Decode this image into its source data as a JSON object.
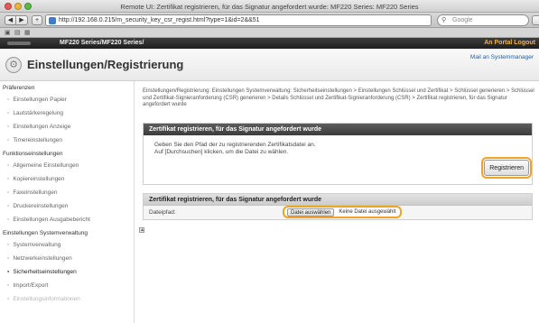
{
  "window": {
    "title": "Remote UI: Zertifikat registrieren, für das Signatur angefordert wurde: MF220 Series: MF220 Series"
  },
  "toolbar": {
    "back_icon": "chevron-left-icon",
    "forward_icon": "chevron-right-icon",
    "url": "http://192.168.0.215/m_security_key_csr_regist.html?type=1&id=2&&51",
    "reload_label": "C",
    "search_placeholder": "Google"
  },
  "appbar": {
    "title": "MF220 Series/MF220 Series/",
    "portal_label": "An Portal  Logout"
  },
  "page": {
    "title": "Einstellungen/Registrierung",
    "mail_link": "Mail an Systemmanager"
  },
  "sidebar": {
    "sections": [
      {
        "label": "Präferenzen",
        "items": [
          {
            "label": "Einstellungen Papier"
          },
          {
            "label": "Lautstärkeregelung"
          },
          {
            "label": "Einstellungen Anzeige"
          },
          {
            "label": "Timereinstellungen"
          }
        ]
      },
      {
        "label": "Funktionseinstellungen",
        "items": [
          {
            "label": "Allgemeine Einstellungen"
          },
          {
            "label": "Kopiereinstellungen"
          },
          {
            "label": "Faxeinstellungen"
          },
          {
            "label": "Druckereinstellungen"
          },
          {
            "label": "Einstellungen Ausgabebericht"
          }
        ]
      },
      {
        "label": "Einstellungen Systemverwaltung",
        "items": [
          {
            "label": "Systemverwaltung"
          },
          {
            "label": "Netzwerkeinstellungen"
          },
          {
            "label": "Sicherheitseinstellungen",
            "active": true
          },
          {
            "label": "Import/Export"
          },
          {
            "label": "Einstellungsinformationen"
          }
        ]
      }
    ]
  },
  "content": {
    "breadcrumb": "Einstellungen/Registrierung: Einstellungen Systemverwaltung: Sicherheitseinstellungen > Einstellungen Schlüssel und Zertifikat > Schlüssel generieren > Schlüssel und Zertifikat-Signieranforderung (CSR) generieren > Details Schlüssel und Zertifikat-Signieranforderung (CSR) > Zertifikat registrieren, für das Signatur angefordert wurde",
    "panel1": {
      "heading": "Zertifikat registrieren, für das Signatur angefordert wurde",
      "line1": "Geben Sie den Pfad der zu registrierenden Zertifikatsdatei an.",
      "line2": "Auf [Durchsuchen] klicken, um die Datei zu wählen.",
      "register_button": "Registrieren"
    },
    "panel2": {
      "heading": "Zertifikat registrieren, für das Signatur angefordert wurde",
      "file_label": "Dateipfad:",
      "choose_button": "Datei auswählen",
      "file_status": "Keine Datei ausgewählt"
    },
    "top_icon": "page-top-icon"
  },
  "colors": {
    "highlight": "#f0a325",
    "appbar": "#2b2b2b",
    "panel_head": "#4a4a4a"
  }
}
